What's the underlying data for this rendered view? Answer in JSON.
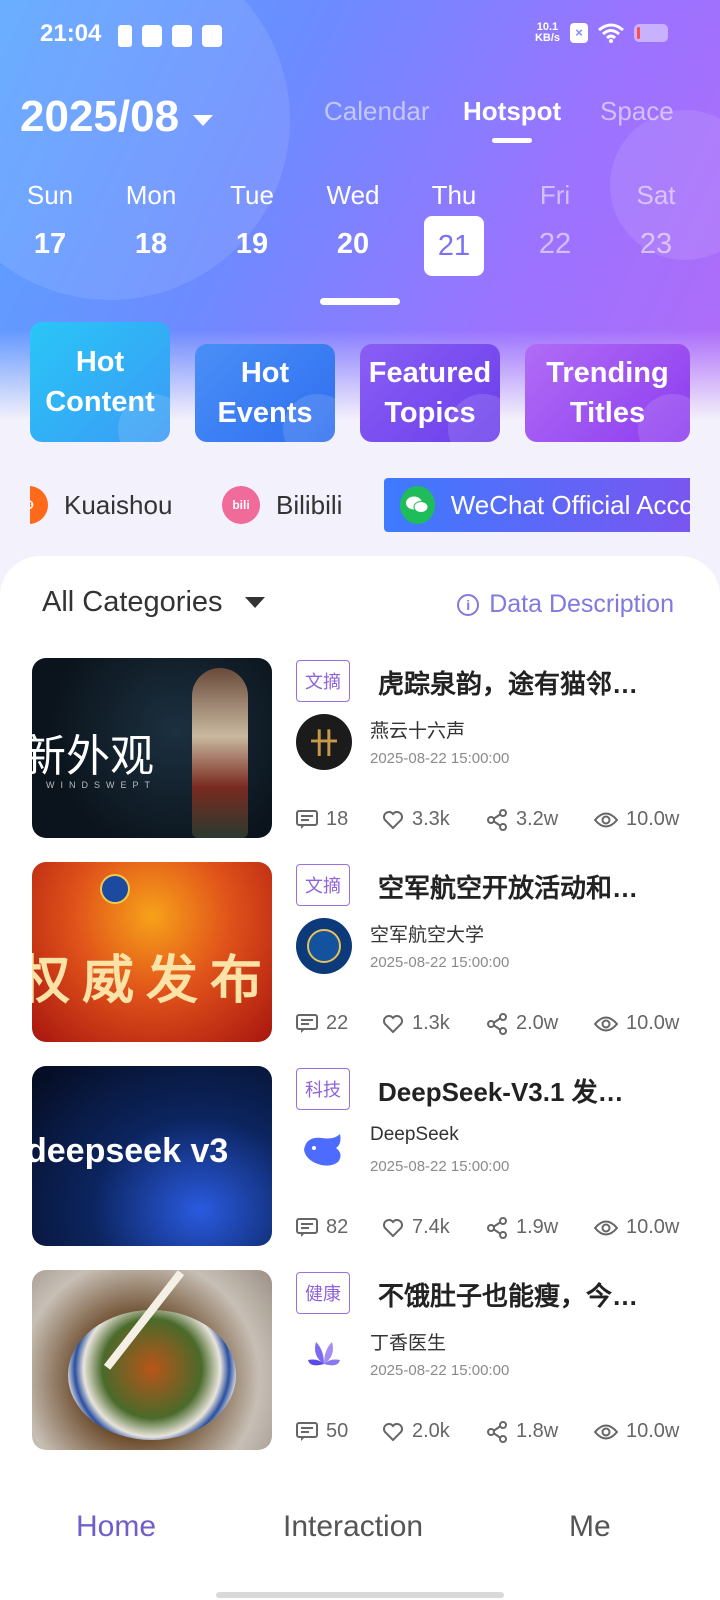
{
  "status_bar": {
    "time": "21:04",
    "net_speed_value": "10.1",
    "net_speed_unit": "KB/s"
  },
  "header": {
    "month": "2025/08",
    "tabs": [
      {
        "label": "Calendar",
        "active": false
      },
      {
        "label": "Hotspot",
        "active": true
      },
      {
        "label": "Space",
        "active": false
      }
    ]
  },
  "week": [
    {
      "name": "Sun",
      "date": "17",
      "state": "past"
    },
    {
      "name": "Mon",
      "date": "18",
      "state": "past"
    },
    {
      "name": "Tue",
      "date": "19",
      "state": "past"
    },
    {
      "name": "Wed",
      "date": "20",
      "state": "selected"
    },
    {
      "name": "Thu",
      "date": "21",
      "state": "today"
    },
    {
      "name": "Fri",
      "date": "22",
      "state": "future"
    },
    {
      "name": "Sat",
      "date": "23",
      "state": "future"
    }
  ],
  "category_cards": [
    {
      "label_line1": "Hot",
      "label_line2": "Content",
      "color": "#2fb8f5"
    },
    {
      "label_line1": "Hot",
      "label_line2": "Events",
      "color": "#3b82f6"
    },
    {
      "label_line1": "Featured",
      "label_line2": "Topics",
      "color": "#7b4ff0"
    },
    {
      "label_line1": "Trending",
      "label_line2": "Titles",
      "color": "#9a4df0"
    }
  ],
  "platforms": [
    {
      "label": "Kuaishou",
      "icon": "kuaishou-icon",
      "color": "#ff6a1a"
    },
    {
      "label": "Bilibili",
      "icon": "bilibili-icon",
      "color": "#f06a9a"
    },
    {
      "label": "WeChat Official Acco",
      "icon": "wechat-icon",
      "color": "#1ebd5a",
      "active": true
    }
  ],
  "filter": {
    "all_categories": "All Categories",
    "data_description": "Data Description"
  },
  "items": [
    {
      "tag": "文摘",
      "title": "虎踪泉韵，途有猫邻…",
      "author": "燕云十六声",
      "date": "2025-08-22 15:00:00",
      "thumb_text": "新外观",
      "thumb_subtext": "WINDSWEPT",
      "comments": "18",
      "likes": "3.3k",
      "shares": "3.2w",
      "views": "10.0w"
    },
    {
      "tag": "文摘",
      "title": "空军航空开放活动和…",
      "author": "空军航空大学",
      "date": "2025-08-22 15:00:00",
      "thumb_text": "权威发布",
      "comments": "22",
      "likes": "1.3k",
      "shares": "2.0w",
      "views": "10.0w"
    },
    {
      "tag": "科技",
      "title": "DeepSeek-V3.1 发…",
      "author": "DeepSeek",
      "date": "2025-08-22 15:00:00",
      "thumb_text": "deepseek v3",
      "comments": "82",
      "likes": "7.4k",
      "shares": "1.9w",
      "views": "10.0w"
    },
    {
      "tag": "健康",
      "title": "不饿肚子也能瘦，今…",
      "author": "丁香医生",
      "date": "2025-08-22 15:00:00",
      "comments": "50",
      "likes": "2.0k",
      "shares": "1.8w",
      "views": "10.0w"
    }
  ],
  "bottom_nav": [
    {
      "label": "Home",
      "active": true
    },
    {
      "label": "Interaction",
      "active": false
    },
    {
      "label": "Me",
      "active": false
    }
  ]
}
